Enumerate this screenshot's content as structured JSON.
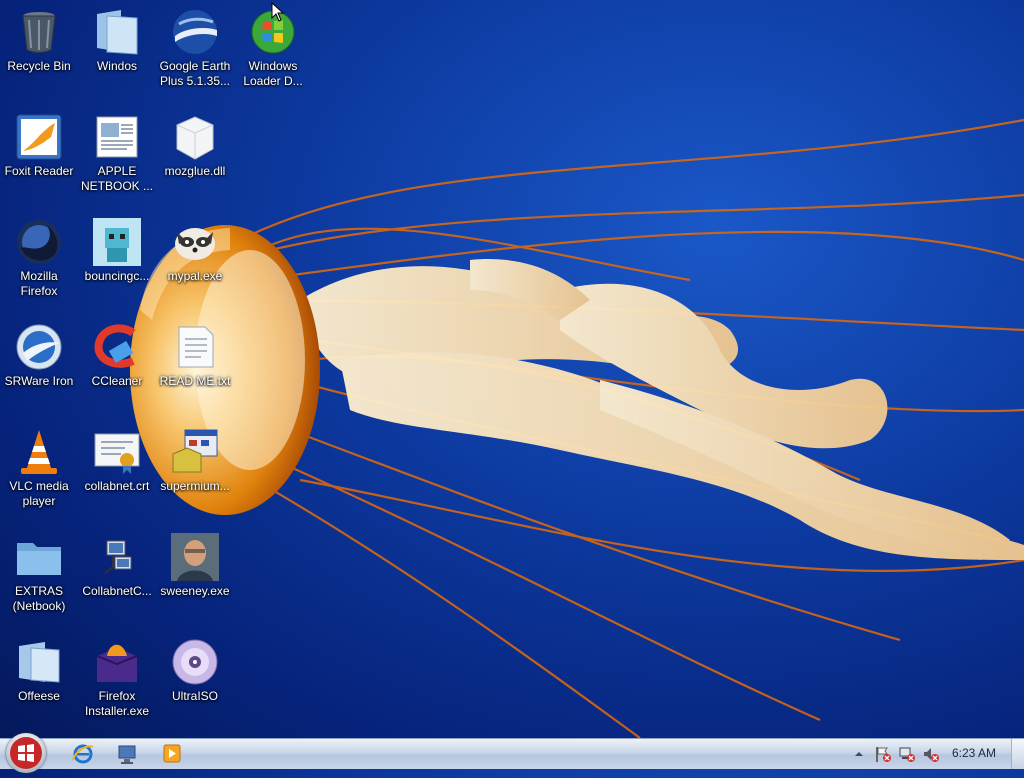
{
  "desktop": {
    "icons": [
      {
        "id": "recycle-bin",
        "label": "Recycle Bin"
      },
      {
        "id": "windos",
        "label": "Windos"
      },
      {
        "id": "google-earth",
        "label": "Google Earth\nPlus 5.1.35..."
      },
      {
        "id": "windows-loader",
        "label": "Windows\nLoader D..."
      },
      {
        "id": "foxit-reader",
        "label": "Foxit Reader"
      },
      {
        "id": "apple-netbook",
        "label": "APPLE\nNETBOOK ..."
      },
      {
        "id": "mozglue",
        "label": "mozglue.dll"
      },
      {
        "id": "mozilla-firefox",
        "label": "Mozilla\nFirefox"
      },
      {
        "id": "bouncingc",
        "label": "bouncingc..."
      },
      {
        "id": "mypal",
        "label": "mypal.exe"
      },
      {
        "id": "srware-iron",
        "label": "SRWare Iron"
      },
      {
        "id": "ccleaner",
        "label": "CCleaner"
      },
      {
        "id": "readme",
        "label": "READ ME.txt"
      },
      {
        "id": "vlc",
        "label": "VLC media\nplayer"
      },
      {
        "id": "collabnet-crt",
        "label": "collabnet.crt"
      },
      {
        "id": "supermium",
        "label": "supermium..."
      },
      {
        "id": "extras-netbook",
        "label": "EXTRAS\n(Netbook)"
      },
      {
        "id": "collabnetc",
        "label": "CollabnetC..."
      },
      {
        "id": "sweeney",
        "label": "sweeney.exe"
      },
      {
        "id": "offeese",
        "label": "Offeese"
      },
      {
        "id": "firefox-installer",
        "label": "Firefox\nInstaller.exe"
      },
      {
        "id": "ultraiso",
        "label": "UltraISO"
      }
    ]
  },
  "taskbar": {
    "clock": "6:23 AM"
  },
  "colors": {
    "desktop_bg": "#0d3aa0",
    "taskbar_bg": "#c8d5e8",
    "jellyfish_orange": "#e8890e"
  }
}
